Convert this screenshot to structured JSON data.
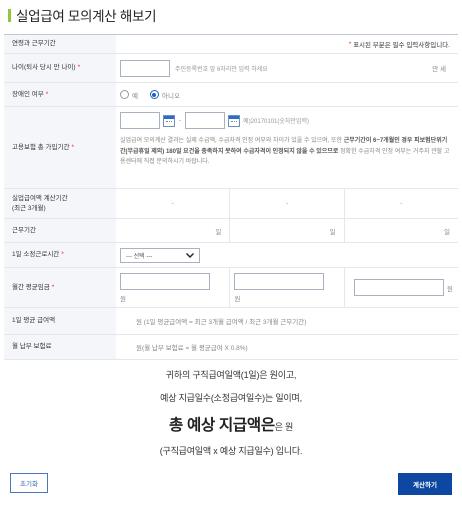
{
  "page": {
    "title": "실업급여 모의계산 해보기"
  },
  "header": {
    "label": "연령과 근무기간",
    "required_note": "표시된 부분은 필수 입력사항입니다."
  },
  "age": {
    "label": "나이(퇴사 당시 만 나이)",
    "hint": "주민등록번호 앞 6자리만 입력 하세요",
    "unit": "만 세"
  },
  "disability": {
    "label": "장애인 여부",
    "options": [
      "예",
      "아니오"
    ],
    "selected": "아니오"
  },
  "insurance_period": {
    "label": "고용보험 총 가입기간",
    "separator": "-",
    "example": "예)20170101(숫자만입력)",
    "notice_prefix": "실업급여 모의계산 결과는 실제 수급액, 수급자격 인정 여부와 차이가 있을 수 있으며, 또한 ",
    "notice_bold": "근무기간이 6~7개월인 경우 피보험단위기간(무급휴일 제외) 180일 요건을 충족하지 못하여 수급자격이 인정되지 않을 수 있으므로",
    "notice_suffix": " 정확한 수급자격 인정 여부는 거주지 관할 고용센터에 직접 문의하시기 바랍니다."
  },
  "calc_period": {
    "label_line1": "실업급여액 계산기간",
    "label_line2": "(최근 3개월)",
    "cells": [
      "-",
      "-",
      "-"
    ]
  },
  "work_days": {
    "label": "근무기간",
    "unit": "일"
  },
  "daily_hours": {
    "label": "1일 소정근로시간",
    "select_value": "--- 선택 ---"
  },
  "monthly_wage": {
    "label": "월간 평균임금",
    "unit": "원"
  },
  "daily_avg": {
    "label": "1일 평균 급여액",
    "text": "원 (1일 평균급여액 = 최근 3개월 급여액 / 최근 3개월 근무기간)"
  },
  "monthly_premium": {
    "label": "월 납부 보험료",
    "text": "원(월 납부 보험료 = 월 평균급여 X 0.8%)"
  },
  "result": {
    "line1": "귀하의 구직급여일액(1일)은 원이고,",
    "line2": "예상 지급일수(소정급여일수)는 일이며,",
    "line3_bold": "총 예상 지급액은",
    "line3_rest": "은 원",
    "line4": "(구직급여일액 x 예상 지급일수) 입니다."
  },
  "buttons": {
    "reset": "초기화",
    "calculate": "계산하기"
  },
  "colors": {
    "accent_green": "#8dc63f",
    "primary_blue": "#0d47a1",
    "required_red": "#e8252f"
  }
}
